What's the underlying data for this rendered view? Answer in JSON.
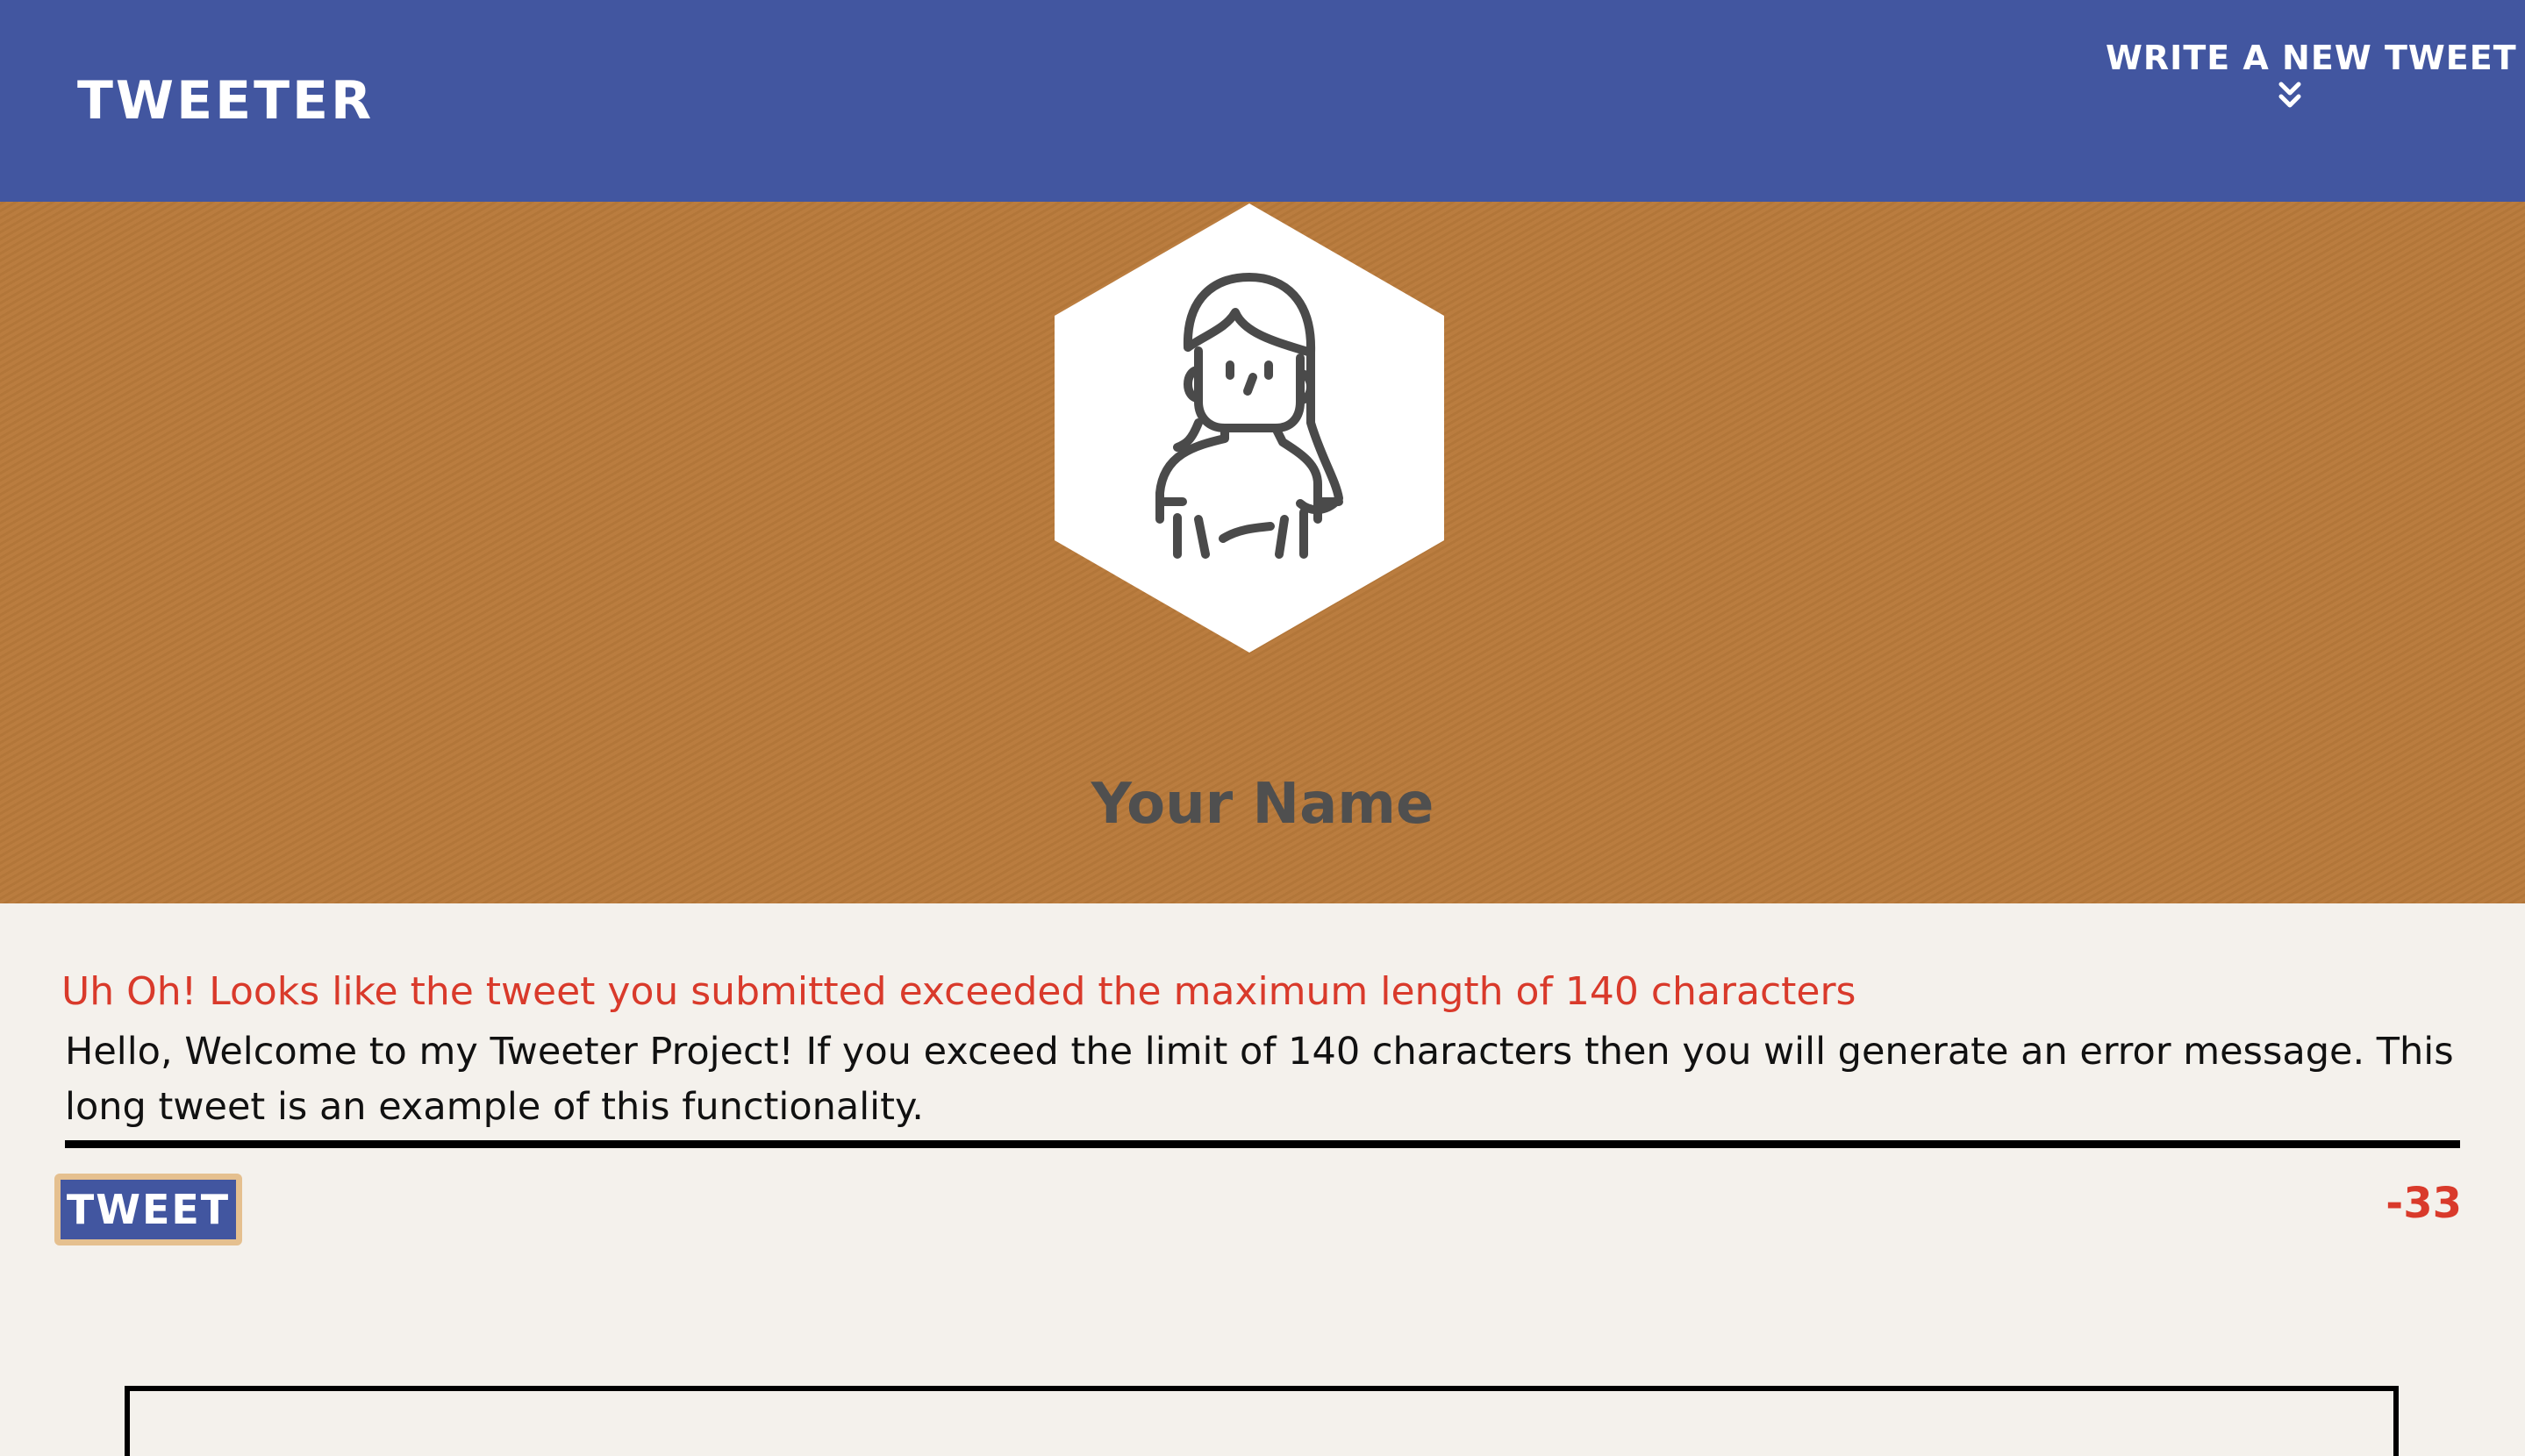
{
  "nav": {
    "brand": "TWEETER",
    "compose_label": "WRITE A NEW TWEET",
    "compose_icon": "chevron-double-down-icon"
  },
  "profile": {
    "avatar_icon": "woman-avatar-icon",
    "name": "Your Name"
  },
  "compose": {
    "error_message": "Uh Oh! Looks like the tweet you submitted exceeded the maximum length of 140 characters",
    "tweet_text": "Hello, Welcome to my Tweeter Project! If you exceed the limit of 140 characters then you will generate an error message. This long tweet is an example of this functionality.",
    "submit_label": "TWEET",
    "counter": "-33"
  },
  "colors": {
    "nav_bg": "#4256a0",
    "header_bg": "#b97a3b",
    "page_bg": "#f4f1ec",
    "error": "#d93a2b",
    "button_border": "#e5c08f"
  }
}
